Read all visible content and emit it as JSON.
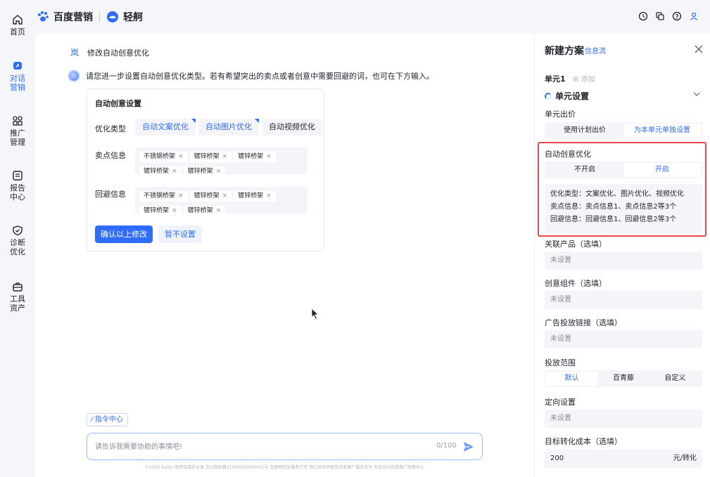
{
  "header": {
    "brand": "百度营销",
    "product": "轻舸"
  },
  "nav": [
    {
      "label": "首页"
    },
    {
      "label": "对话\n营销"
    },
    {
      "label": "推广\n管理"
    },
    {
      "label": "报告\n中心"
    },
    {
      "label": "诊断\n优化"
    },
    {
      "label": "工具\n资产"
    }
  ],
  "chat": {
    "user_name": "岚",
    "user_message": "修改自动创意优化",
    "bot_message": "请您进一步设置自动创意优化类型。若有希望突出的卖点或者创意中需要回避的词，也可在下方输入。",
    "card": {
      "title": "自动创意设置",
      "type_label": "优化类型",
      "options": [
        "自动文案优化",
        "自动图片优化",
        "自动视频优化"
      ],
      "selling_label": "卖点信息",
      "selling_tags": [
        "不锈钢桥架",
        "镀锌桥架",
        "镀锌桥架",
        "镀锌桥架",
        "镀锌桥架"
      ],
      "avoid_label": "回避信息",
      "avoid_tags": [
        "不锈钢桥架",
        "镀锌桥架",
        "镀锌桥架",
        "镀锌桥架",
        "镀锌桥架"
      ],
      "confirm": "确认以上修改",
      "skip": "暂不设置"
    },
    "command_chip": "指令中心",
    "input_placeholder": "请告诉我需要协助的事情吧!",
    "counter": "0/100",
    "footer": "©2024 Baidu 使用百度前必读 京公网安备11000002000001号 互联网信息服务许可 我已阅读并接受百度推广服务合同 欢迎访问百度推广政策中心"
  },
  "panel": {
    "title": "新建方案",
    "badge": "信息流",
    "unit_tab": "单元1",
    "unit_add": "添加",
    "unit_settings": "单元设置",
    "bid_label": "单元出价",
    "bid_options": [
      "使用计划出价",
      "为本单元单独设置"
    ],
    "auto_label": "自动创意优化",
    "auto_options": [
      "不开启",
      "开启"
    ],
    "summary": [
      "优化类型：文案优化、图片优化、视频优化",
      "卖点信息：卖点信息1、卖点信息2等3个",
      "回避信息：回避信息1、回避信息2等3个"
    ],
    "product_label": "关联产品（选填）",
    "product_value": "未设置",
    "component_label": "创意组件（选填）",
    "component_value": "未设置",
    "link_label": "广告投放链接（选填）",
    "link_value": "未设置",
    "scope_label": "投放范围",
    "scope_options": [
      "默认",
      "百青藤",
      "自定义"
    ],
    "targeting_label": "定向设置",
    "targeting_value": "未设置",
    "cost_label": "目标转化成本（选填）",
    "cost_value": "200",
    "cost_unit": "元/转化"
  }
}
